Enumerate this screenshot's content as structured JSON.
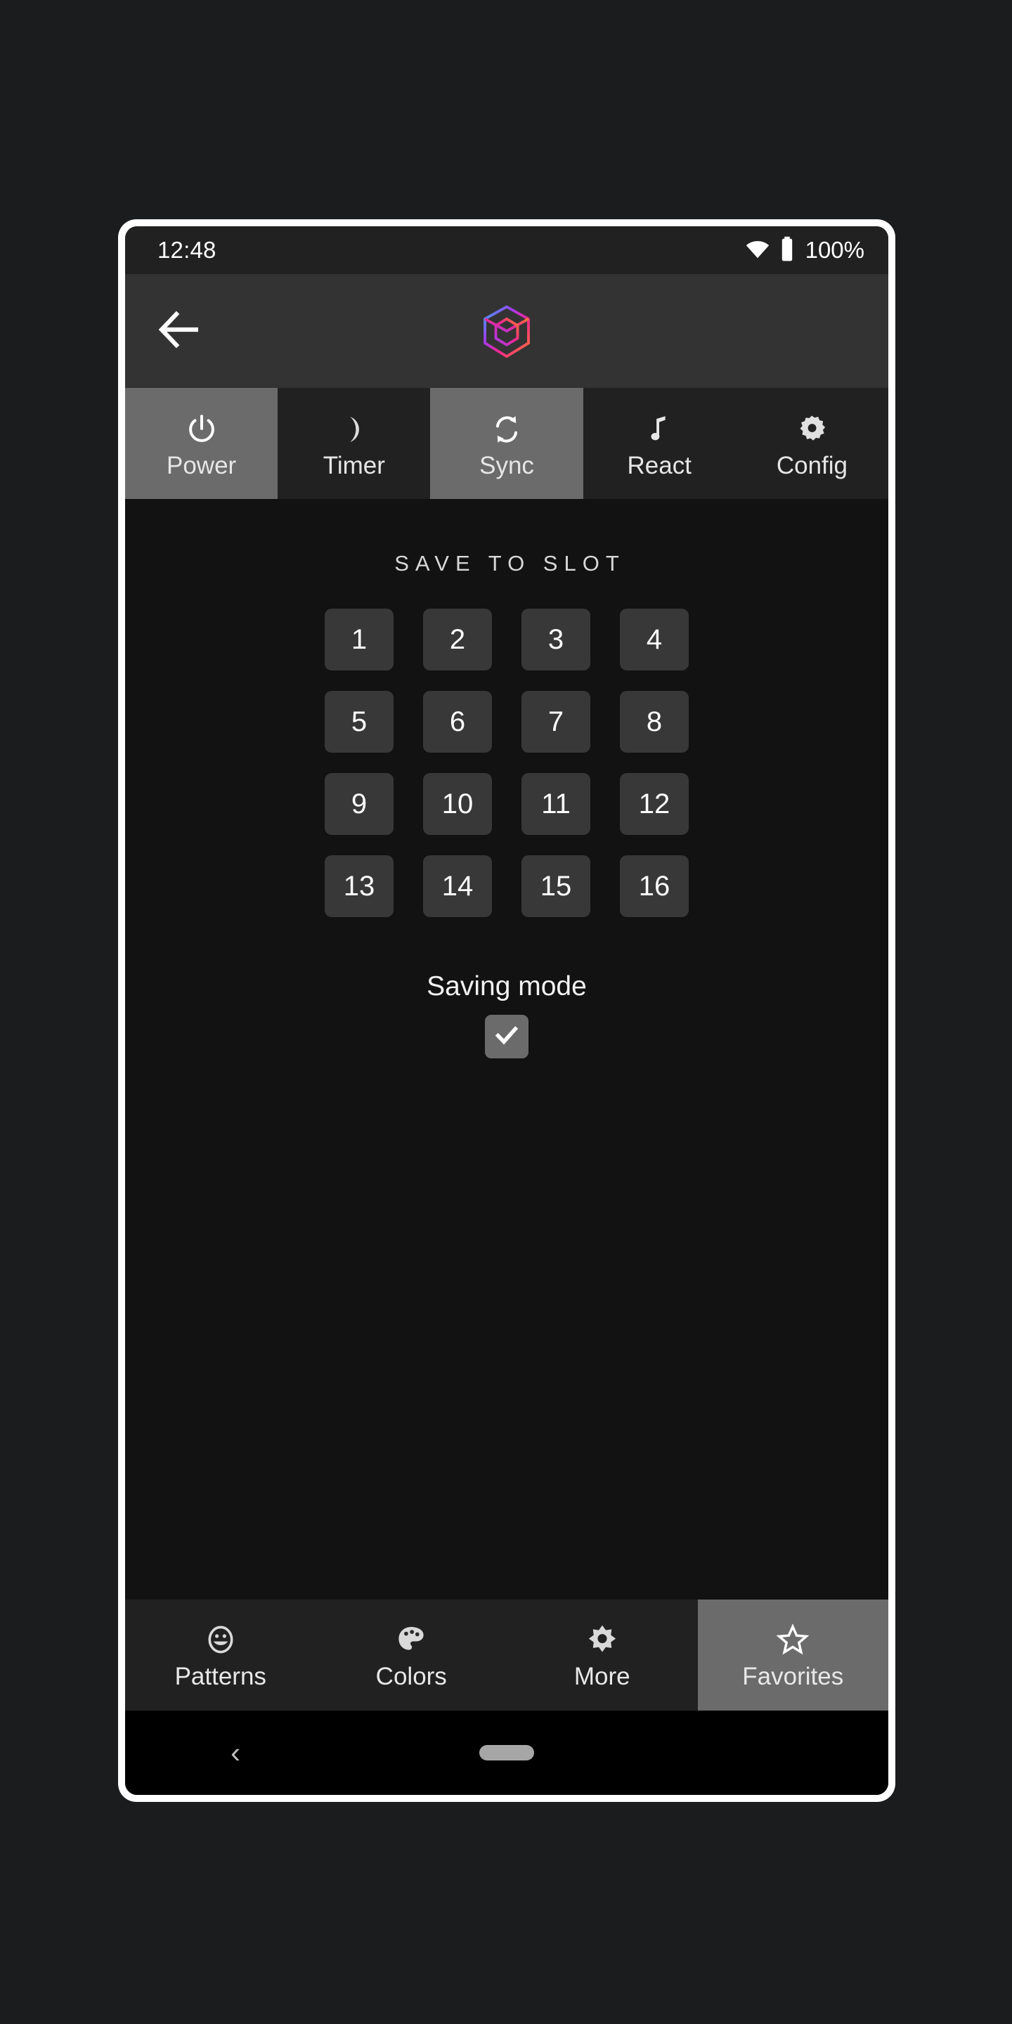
{
  "status_bar": {
    "clock": "12:48",
    "battery_percent": "100%",
    "wifi_icon": "wifi-icon",
    "battery_icon": "battery-full-icon"
  },
  "header": {
    "back_icon": "back-arrow-icon",
    "logo_icon": "cube-logo-icon",
    "logo_colors": [
      "#ff7a2f",
      "#f0268f",
      "#a13bf0",
      "#29b6f6"
    ],
    "background": "#333333"
  },
  "top_tabs": {
    "items": [
      {
        "label": "Power",
        "icon": "power-icon",
        "active": true
      },
      {
        "label": "Timer",
        "icon": "moon-icon",
        "active": false
      },
      {
        "label": "Sync",
        "icon": "sync-icon",
        "active": true
      },
      {
        "label": "React",
        "icon": "music-note-icon",
        "active": false
      },
      {
        "label": "Config",
        "icon": "gear-icon",
        "active": false
      }
    ],
    "active_background": "#6b6b6b",
    "inactive_background": "#212121"
  },
  "content": {
    "section_title": "SAVE TO SLOT",
    "slots": [
      "1",
      "2",
      "3",
      "4",
      "5",
      "6",
      "7",
      "8",
      "9",
      "10",
      "11",
      "12",
      "13",
      "14",
      "15",
      "16"
    ],
    "saving_mode": {
      "label": "Saving mode",
      "checked": true,
      "check_icon": "checkmark-icon"
    },
    "background": "#121212",
    "slot_background": "#383838"
  },
  "bottom_nav": {
    "items": [
      {
        "label": "Patterns",
        "icon": "smiley-face-icon",
        "active": false
      },
      {
        "label": "Colors",
        "icon": "palette-icon",
        "active": false
      },
      {
        "label": "More",
        "icon": "brightness-icon",
        "active": false
      },
      {
        "label": "Favorites",
        "icon": "star-outline-icon",
        "active": true
      }
    ],
    "active_background": "#6b6b6b"
  },
  "system_nav": {
    "back_glyph": "‹",
    "back_icon": "system-back-icon",
    "home_icon": "system-home-pill-icon"
  }
}
